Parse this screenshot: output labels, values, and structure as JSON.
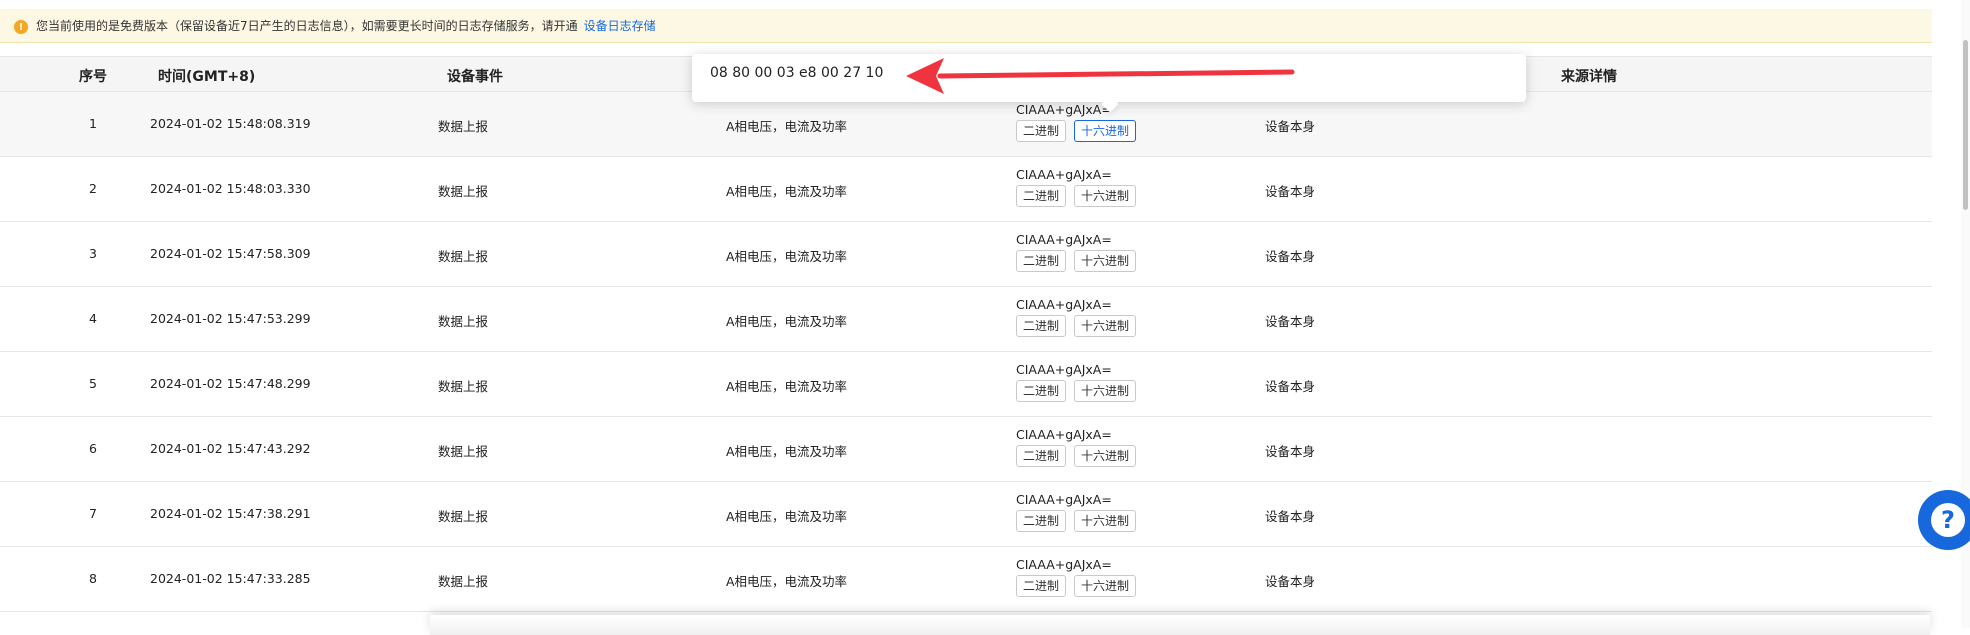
{
  "banner": {
    "text": "您当前使用的是免费版本（保留设备近7日产生的日志信息），如需要更长时间的日志存储服务，请开通",
    "link": "设备日志存储",
    "icon": "warning-icon"
  },
  "table": {
    "headers": {
      "index": "序号",
      "time": "时间(GMT+8)",
      "event": "设备事件",
      "source": "来源详情"
    },
    "rows": [
      {
        "index": "1",
        "time": "2024-01-02 15:48:08.319",
        "event": "数据上报",
        "desc": "A相电压，电流及功率",
        "value": "CIAAA+gAJxA=",
        "bin": "二进制",
        "hex": "十六进制",
        "source": "设备本身"
      },
      {
        "index": "2",
        "time": "2024-01-02 15:48:03.330",
        "event": "数据上报",
        "desc": "A相电压，电流及功率",
        "value": "CIAAA+gAJxA=",
        "bin": "二进制",
        "hex": "十六进制",
        "source": "设备本身"
      },
      {
        "index": "3",
        "time": "2024-01-02 15:47:58.309",
        "event": "数据上报",
        "desc": "A相电压，电流及功率",
        "value": "CIAAA+gAJxA=",
        "bin": "二进制",
        "hex": "十六进制",
        "source": "设备本身"
      },
      {
        "index": "4",
        "time": "2024-01-02 15:47:53.299",
        "event": "数据上报",
        "desc": "A相电压，电流及功率",
        "value": "CIAAA+gAJxA=",
        "bin": "二进制",
        "hex": "十六进制",
        "source": "设备本身"
      },
      {
        "index": "5",
        "time": "2024-01-02 15:47:48.299",
        "event": "数据上报",
        "desc": "A相电压，电流及功率",
        "value": "CIAAA+gAJxA=",
        "bin": "二进制",
        "hex": "十六进制",
        "source": "设备本身"
      },
      {
        "index": "6",
        "time": "2024-01-02 15:47:43.292",
        "event": "数据上报",
        "desc": "A相电压，电流及功率",
        "value": "CIAAA+gAJxA=",
        "bin": "二进制",
        "hex": "十六进制",
        "source": "设备本身"
      },
      {
        "index": "7",
        "time": "2024-01-02 15:47:38.291",
        "event": "数据上报",
        "desc": "A相电压，电流及功率",
        "value": "CIAAA+gAJxA=",
        "bin": "二进制",
        "hex": "十六进制",
        "source": "设备本身"
      },
      {
        "index": "8",
        "time": "2024-01-02 15:47:33.285",
        "event": "数据上报",
        "desc": "A相电压，电流及功率",
        "value": "CIAAA+gAJxA=",
        "bin": "二进制",
        "hex": "十六进制",
        "source": "设备本身"
      }
    ]
  },
  "popover": {
    "hex_value": "08 80 00 03 e8 00 27 10"
  },
  "colors": {
    "accent": "#1668dc",
    "arrow": "#f0343f",
    "banner_bg": "#fdf8e4",
    "warning": "#f5a623"
  },
  "help": {
    "icon": "help-icon",
    "symbol": "?"
  }
}
